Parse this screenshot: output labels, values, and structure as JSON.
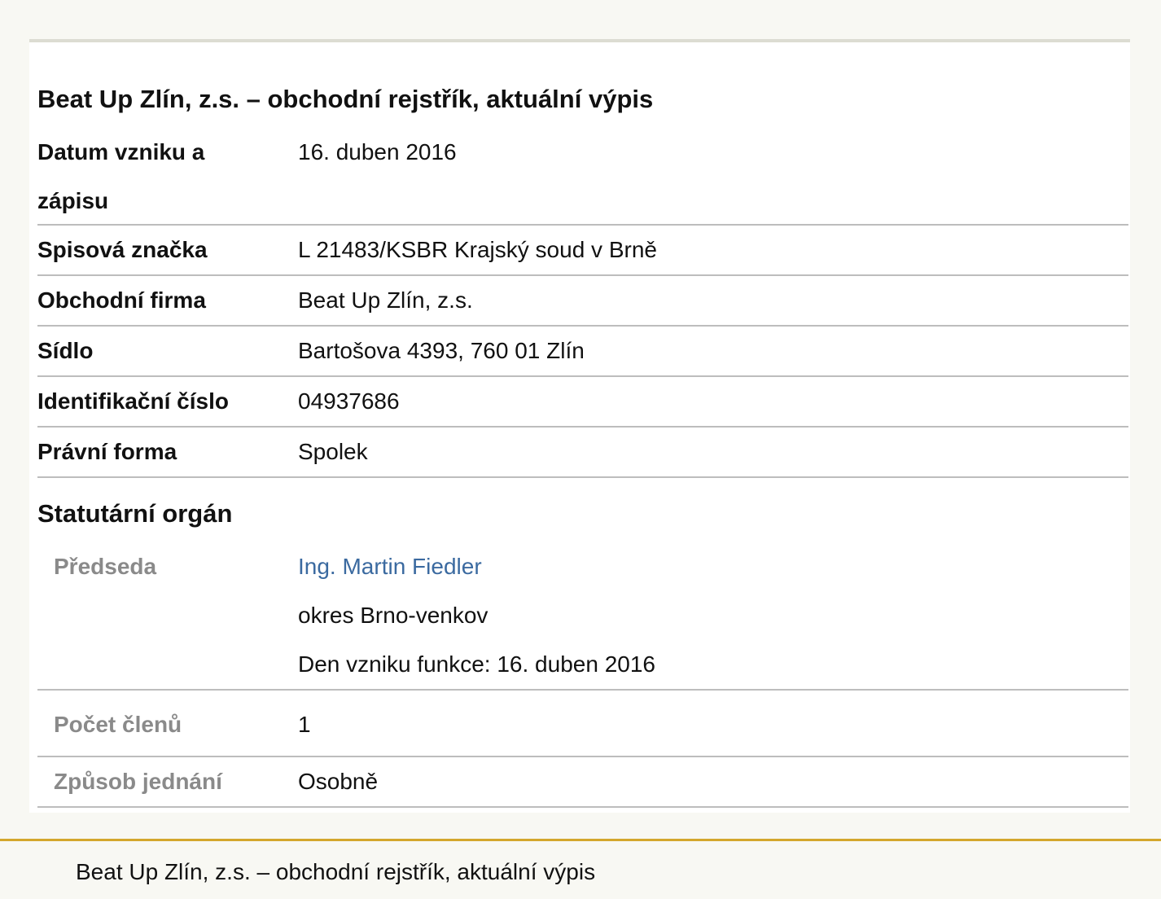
{
  "page_title": "Beat Up Zlín, z.s. – obchodní rejstřík, aktuální výpis",
  "rows": [
    {
      "label": "Datum vzniku a zápisu",
      "value": "16. duben 2016"
    },
    {
      "label": "Spisová značka",
      "value": "L 21483/KSBR Krajský soud v Brně"
    },
    {
      "label": "Obchodní firma",
      "value": "Beat Up Zlín, z.s."
    },
    {
      "label": "Sídlo",
      "value": "Bartošova 4393, 760 01 Zlín"
    },
    {
      "label": "Identifikační číslo",
      "value": "04937686"
    },
    {
      "label": "Právní forma",
      "value": "Spolek"
    }
  ],
  "statutory": {
    "heading": "Statutární orgán",
    "chair_label": "Předseda",
    "chair_name": "Ing. Martin Fiedler",
    "chair_district": "okres Brno-venkov",
    "chair_since": "Den vzniku funkce: 16. duben 2016",
    "members_label": "Počet členů",
    "members_value": "1",
    "acting_label": "Způsob jednání",
    "acting_value": "Osobně"
  },
  "footer": {
    "text": "Beat Up Zlín, z.s. – obchodní rejstřík, aktuální výpis"
  },
  "colors": {
    "link": "#3b6aa0",
    "footer_border": "#d4a72c",
    "sub_label": "#8a8a8a"
  }
}
